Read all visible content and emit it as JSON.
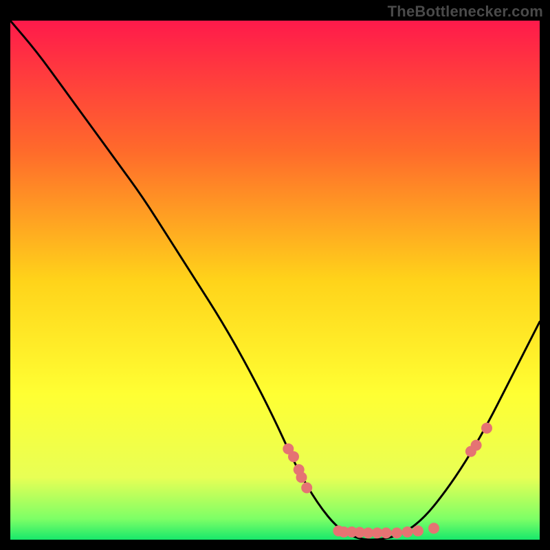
{
  "watermark": "TheBottlenecker.com",
  "chart_data": {
    "type": "line",
    "title": "",
    "xlabel": "",
    "ylabel": "",
    "xlim": [
      0,
      100
    ],
    "ylim": [
      0,
      100
    ],
    "gradient_stops": [
      {
        "offset": 0,
        "color": "#ff1a4b"
      },
      {
        "offset": 25,
        "color": "#ff6a2b"
      },
      {
        "offset": 50,
        "color": "#ffd31a"
      },
      {
        "offset": 72,
        "color": "#ffff33"
      },
      {
        "offset": 88,
        "color": "#e8ff55"
      },
      {
        "offset": 96,
        "color": "#7dff66"
      },
      {
        "offset": 100,
        "color": "#17e86b"
      }
    ],
    "series": [
      {
        "name": "bottleneck-curve",
        "x": [
          0,
          5,
          10,
          15,
          20,
          25,
          30,
          35,
          40,
          45,
          50,
          54,
          58,
          62,
          66,
          70,
          74,
          78,
          82,
          86,
          90,
          94,
          98,
          100
        ],
        "y": [
          100,
          94,
          87,
          80,
          73,
          66,
          58,
          50,
          42,
          33,
          23,
          14,
          7,
          2,
          0,
          0,
          1,
          4,
          9,
          15,
          22,
          30,
          38,
          42
        ]
      }
    ],
    "markers": [
      {
        "x": 52.5,
        "y": 17.5
      },
      {
        "x": 53.5,
        "y": 16.0
      },
      {
        "x": 54.5,
        "y": 13.5
      },
      {
        "x": 55.0,
        "y": 12.0
      },
      {
        "x": 56.0,
        "y": 10.0
      },
      {
        "x": 62.0,
        "y": 1.7
      },
      {
        "x": 63.0,
        "y": 1.5
      },
      {
        "x": 64.5,
        "y": 1.5
      },
      {
        "x": 66.0,
        "y": 1.4
      },
      {
        "x": 67.6,
        "y": 1.3
      },
      {
        "x": 69.3,
        "y": 1.3
      },
      {
        "x": 71.0,
        "y": 1.3
      },
      {
        "x": 73.0,
        "y": 1.3
      },
      {
        "x": 75.0,
        "y": 1.5
      },
      {
        "x": 77.0,
        "y": 1.7
      },
      {
        "x": 80.0,
        "y": 2.2
      },
      {
        "x": 87.0,
        "y": 17.0
      },
      {
        "x": 88.0,
        "y": 18.2
      },
      {
        "x": 90.0,
        "y": 21.5
      }
    ],
    "marker_color": "#e57373",
    "marker_radius": 8,
    "curve_color": "#000000",
    "curve_width": 3
  }
}
